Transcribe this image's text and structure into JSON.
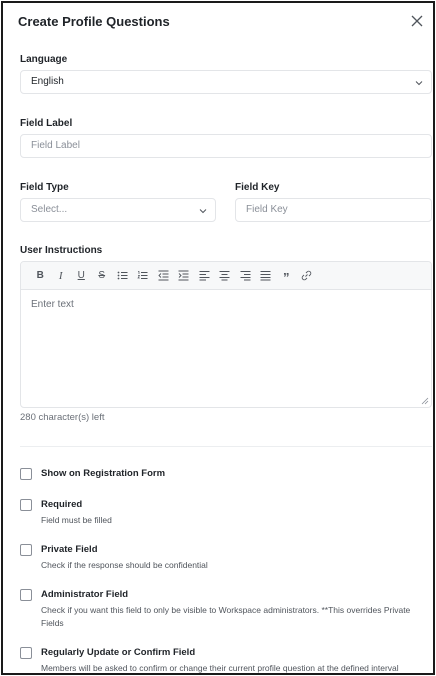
{
  "dialog": {
    "title": "Create Profile Questions"
  },
  "language": {
    "label": "Language",
    "value": "English"
  },
  "field_label": {
    "label": "Field Label",
    "placeholder": "Field Label"
  },
  "field_type": {
    "label": "Field Type",
    "placeholder": "Select..."
  },
  "field_key": {
    "label": "Field Key",
    "placeholder": "Field Key"
  },
  "instructions": {
    "label": "User Instructions",
    "placeholder": "Enter text",
    "counter": "280 character(s) left",
    "toolbar": {
      "bold": "B",
      "italic": "I",
      "underline": "U",
      "strike": "S",
      "quote": "”"
    }
  },
  "options": [
    {
      "title": "Show on Registration Form",
      "desc": ""
    },
    {
      "title": "Required",
      "desc": "Field must be filled"
    },
    {
      "title": "Private Field",
      "desc": "Check if the response should be confidential"
    },
    {
      "title": "Administrator Field",
      "desc": "Check if you want this field to only be visible to Workspace administrators. **This overrides Private Fields"
    },
    {
      "title": "Regularly Update or Confirm Field",
      "desc": "Members will be asked to confirm or change their current profile question at the defined interval"
    }
  ]
}
